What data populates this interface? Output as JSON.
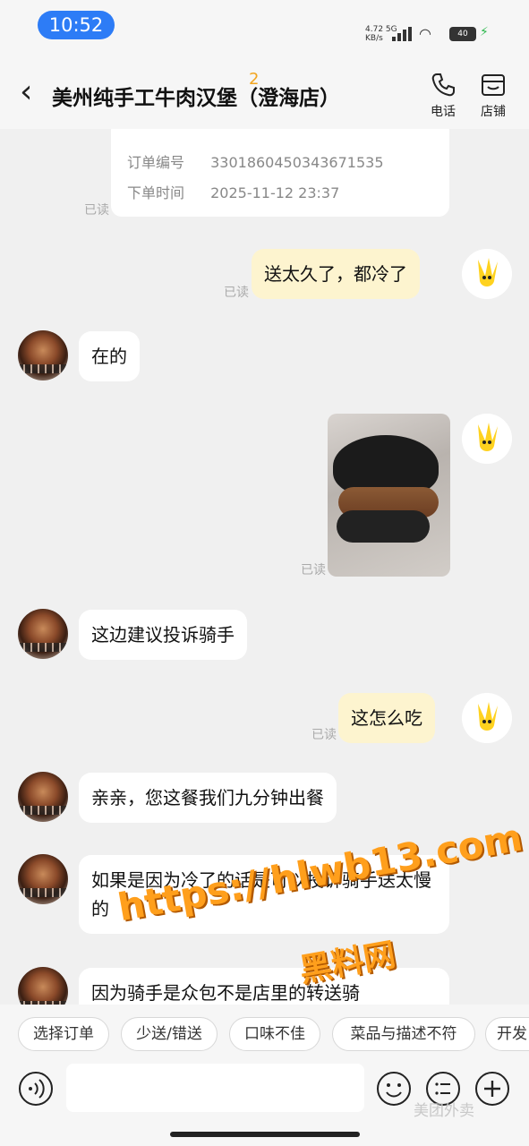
{
  "status": {
    "time": "10:52",
    "net_speed": "4.72 5G\nKB/s",
    "battery": "40"
  },
  "header": {
    "title": "美州纯手工牛肉汉堡（澄海店）",
    "unread_badge": "2",
    "phone_label": "电话",
    "store_label": "店铺"
  },
  "order": {
    "number_label": "订单编号",
    "number_value": "3301860450343671535",
    "time_label": "下单时间",
    "time_value": "2025-11-12 23:37"
  },
  "read_label": "已读",
  "messages": [
    {
      "side": "me",
      "text": "送太久了，都冷了"
    },
    {
      "side": "them",
      "text": "在的"
    },
    {
      "side": "me",
      "type": "image",
      "image_desc": "photo-of-burger"
    },
    {
      "side": "them",
      "text": "这边建议投诉骑手"
    },
    {
      "side": "me",
      "text": "这怎么吃"
    },
    {
      "side": "them",
      "text": "亲亲，您这餐我们九分钟出餐"
    },
    {
      "side": "them",
      "text": "如果是因为冷了的话是可以投诉骑手送太慢的"
    },
    {
      "side": "them",
      "text": "因为骑手是众包不是店里的转送骑"
    }
  ],
  "watermark": {
    "url": "https://hlwb13.com",
    "site": "黑料网"
  },
  "quick_replies": [
    "选择订单",
    "少送/错送",
    "口味不佳",
    "菜品与描述不符",
    "开发"
  ],
  "input": {
    "placeholder": ""
  },
  "brand_watermark": "美团外卖",
  "colors": {
    "me_bubble": "#fdf4cf",
    "them_bubble": "#ffffff",
    "accent": "#f2a520",
    "time_pill": "#2d7cf6"
  }
}
